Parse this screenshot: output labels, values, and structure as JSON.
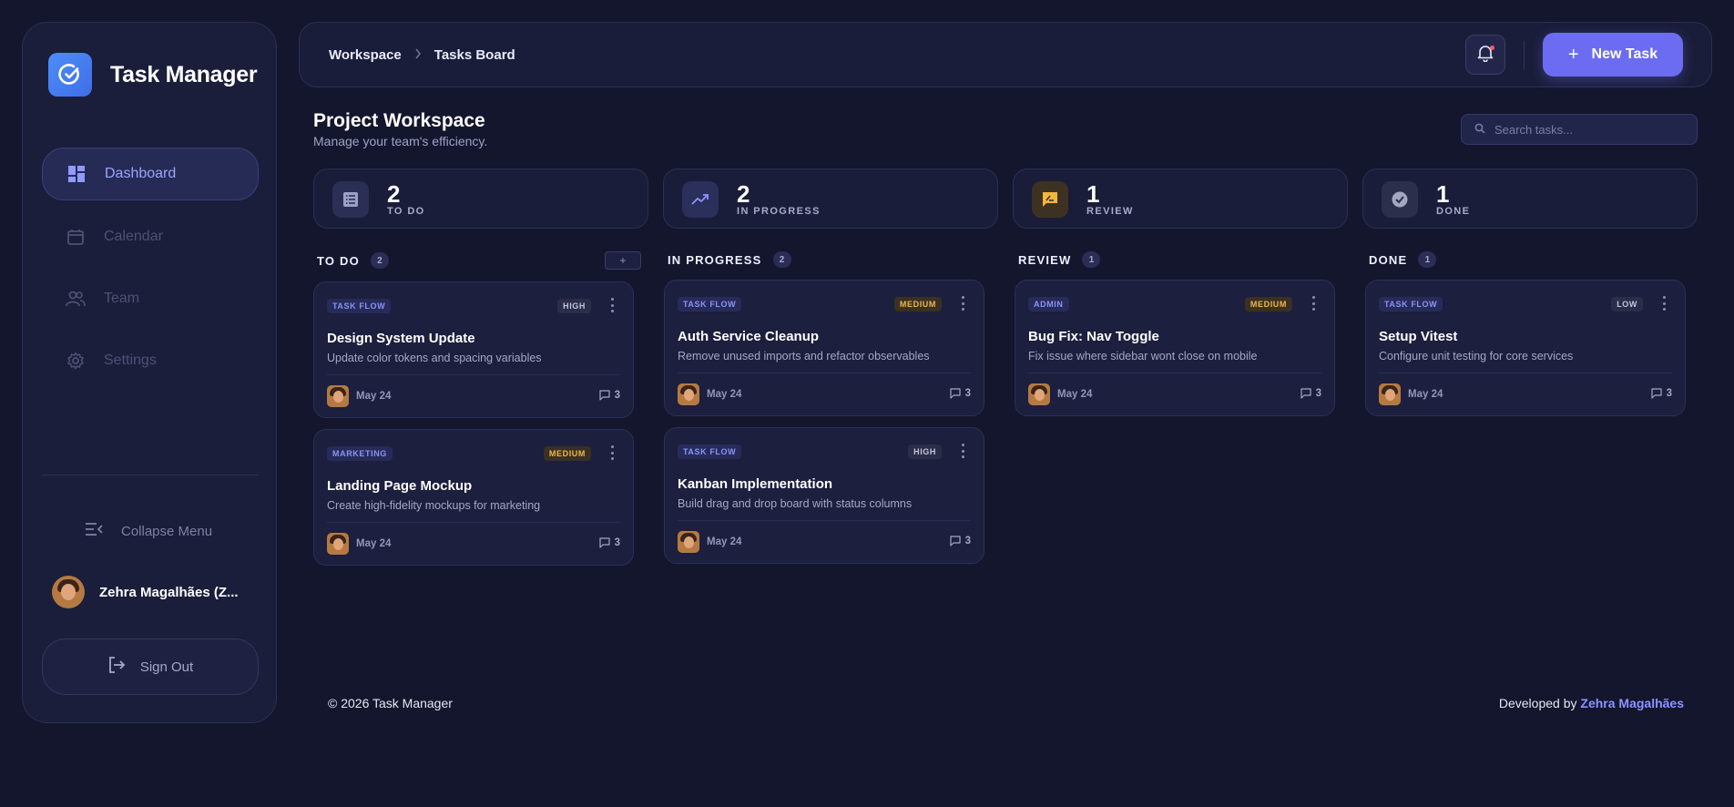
{
  "app": {
    "title": "Task Manager"
  },
  "sidebar": {
    "items": [
      {
        "label": "Dashboard",
        "icon": "dashboard-icon",
        "active": true
      },
      {
        "label": "Calendar",
        "icon": "calendar-icon",
        "active": false
      },
      {
        "label": "Team",
        "icon": "team-icon",
        "active": false
      },
      {
        "label": "Settings",
        "icon": "settings-icon",
        "active": false
      }
    ],
    "collapse_label": "Collapse Menu",
    "user_name": "Zehra Magalhães (Z...",
    "signout_label": "Sign Out"
  },
  "header": {
    "breadcrumb": [
      "Workspace",
      "Tasks Board"
    ],
    "new_task_label": "New Task",
    "accent": "#6b6cf2"
  },
  "page": {
    "title": "Project Workspace",
    "subtitle": "Manage your team's efficiency.",
    "search_placeholder": "Search tasks..."
  },
  "stats": [
    {
      "value": "2",
      "label": "TO DO",
      "icon": "list-icon"
    },
    {
      "value": "2",
      "label": "IN PROGRESS",
      "icon": "trending-up-icon"
    },
    {
      "value": "1",
      "label": "REVIEW",
      "icon": "review-icon"
    },
    {
      "value": "1",
      "label": "DONE",
      "icon": "check-circle-icon"
    }
  ],
  "columns": [
    {
      "title": "TO DO",
      "count": "2",
      "add_label": "+"
    },
    {
      "title": "IN PROGRESS",
      "count": "2"
    },
    {
      "title": "REVIEW",
      "count": "1"
    },
    {
      "title": "DONE",
      "count": "1"
    }
  ],
  "cards": [
    {
      "tag": "TASK FLOW",
      "priority": "HIGH",
      "title": "Design System Update",
      "desc": "Update color tokens and spacing variables",
      "date": "May 24",
      "comments": "3"
    },
    {
      "tag": "MARKETING",
      "priority": "MEDIUM",
      "title": "Landing Page Mockup",
      "desc": "Create high-fidelity mockups for marketing",
      "date": "May 24",
      "comments": "3"
    },
    {
      "tag": "TASK FLOW",
      "priority": "MEDIUM",
      "title": "Auth Service Cleanup",
      "desc": "Remove unused imports and refactor observables",
      "date": "May 24",
      "comments": "3"
    },
    {
      "tag": "TASK FLOW",
      "priority": "HIGH",
      "title": "Kanban Implementation",
      "desc": "Build drag and drop board with status columns",
      "date": "May 24",
      "comments": "3"
    },
    {
      "tag": "ADMIN",
      "priority": "MEDIUM",
      "title": "Bug Fix: Nav Toggle",
      "desc": "Fix issue where sidebar wont close on mobile",
      "date": "May 24",
      "comments": "3"
    },
    {
      "tag": "TASK FLOW",
      "priority": "LOW",
      "title": "Setup Vitest",
      "desc": "Configure unit testing for core services",
      "date": "May 24",
      "comments": "3"
    }
  ],
  "footer": {
    "copyright": "© 2026 Task Manager",
    "developed_by": "Developed by",
    "developer": "Zehra Magalhães"
  }
}
